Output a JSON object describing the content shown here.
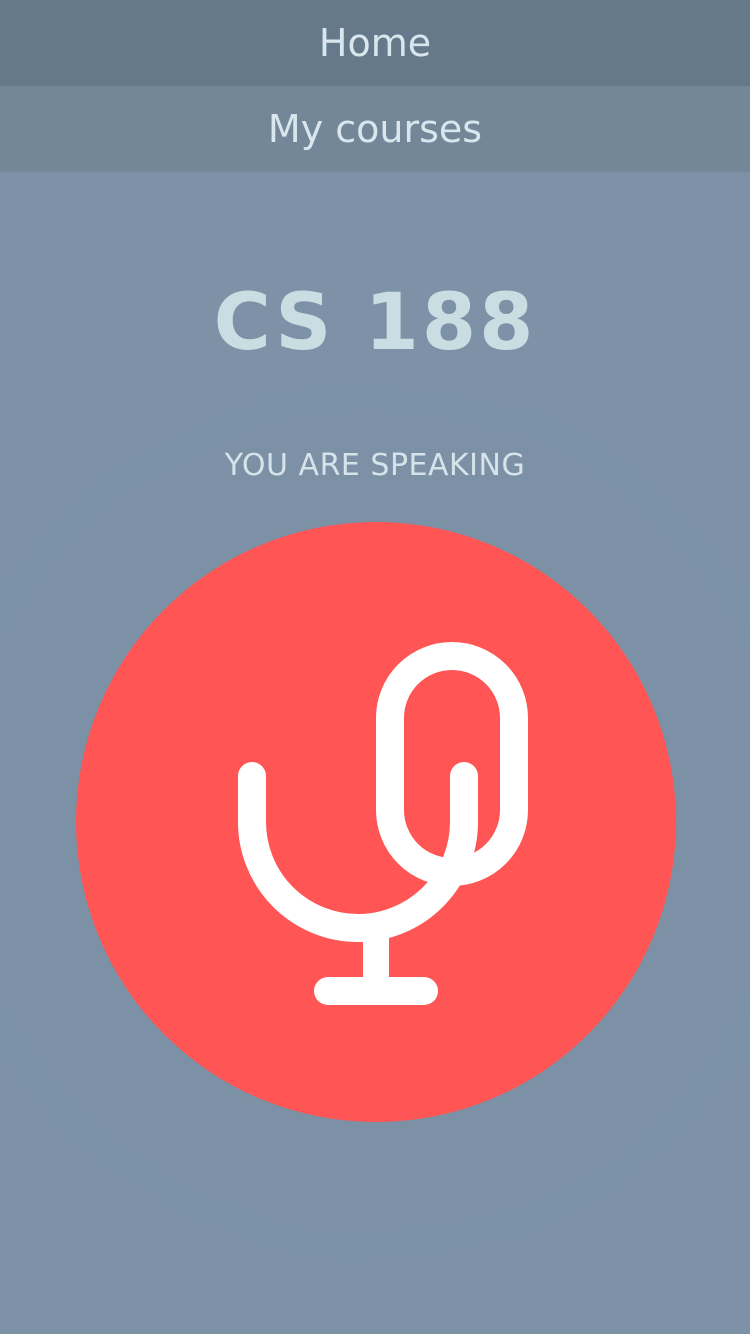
{
  "nav": {
    "home_label": "Home",
    "courses_label": "My courses"
  },
  "course": {
    "title": "CS 188"
  },
  "status": {
    "text": "YOU ARE SPEAKING"
  },
  "mic": {
    "icon": "microphone-icon",
    "state": "speaking"
  },
  "colors": {
    "background": "#7d92a6",
    "nav_home_bg": "#66798b",
    "nav_courses_bg": "#738799",
    "mic_button": "#ff5555",
    "title_text": "#c9dde2"
  }
}
